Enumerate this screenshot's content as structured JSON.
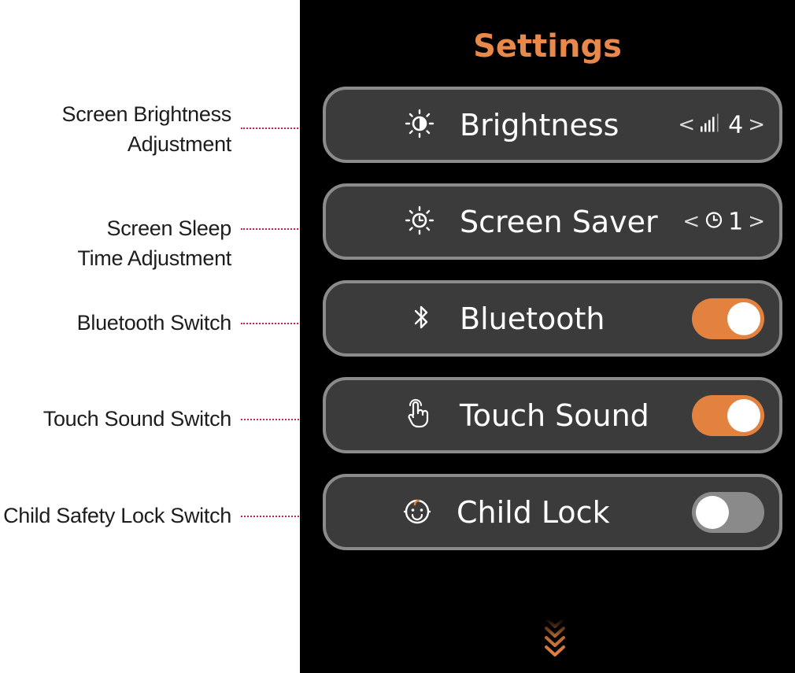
{
  "annotations": {
    "brightness": [
      "Screen Brightness",
      "Adjustment"
    ],
    "screen_saver": [
      "Screen Sleep",
      "Time Adjustment"
    ],
    "bluetooth": "Bluetooth Switch",
    "touch_sound": "Touch Sound Switch",
    "child_lock": "Child Safety Lock Switch"
  },
  "settings": {
    "title": "Settings",
    "brightness": {
      "label": "Brightness",
      "value": "4",
      "icon": "brightness-icon"
    },
    "screen_saver": {
      "label": "Screen Saver",
      "value": "1",
      "icon": "screen-saver-icon"
    },
    "bluetooth": {
      "label": "Bluetooth",
      "on": true,
      "icon": "bluetooth-icon"
    },
    "touch_sound": {
      "label": "Touch Sound",
      "on": true,
      "icon": "touch-hand-icon"
    },
    "child_lock": {
      "label": "Child Lock",
      "on": false,
      "icon": "child-face-icon"
    }
  },
  "colors": {
    "accent": "#e3823f",
    "title": "#e8884a",
    "row_bg": "#3b3b3b",
    "row_border": "#8b8b8b",
    "leader": "#c8244a",
    "toggle_off": "#8a8a8a"
  },
  "icons": {
    "stepper_prev": "<",
    "stepper_next": ">",
    "scroll_more": "chevrons-down-icon"
  }
}
